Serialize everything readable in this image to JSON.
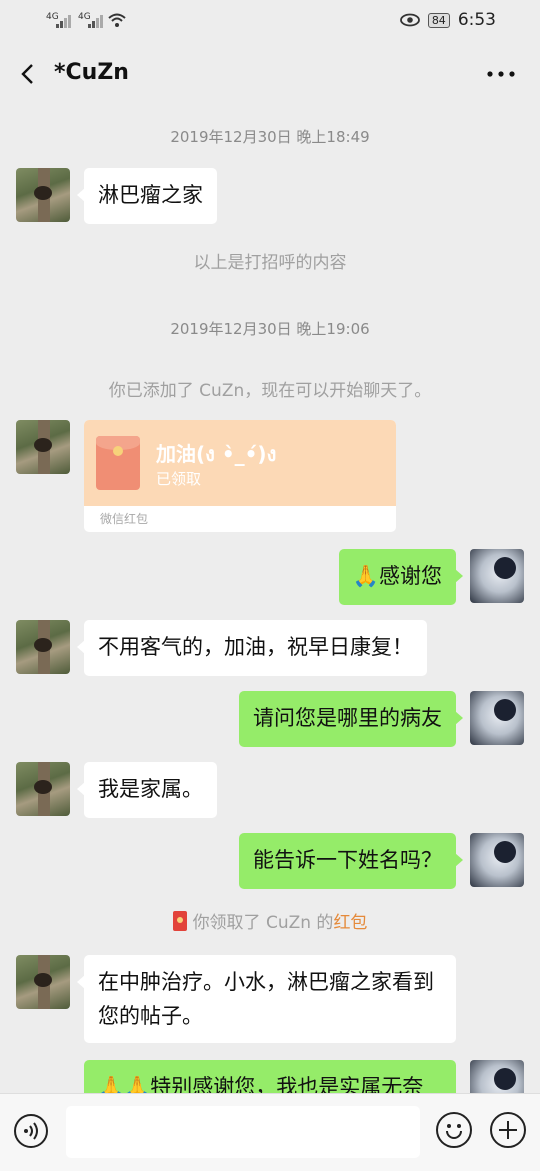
{
  "status_bar": {
    "signal_1": "4G",
    "signal_2": "4G",
    "battery": "84",
    "time": "6:53"
  },
  "header": {
    "title": "*CuZn",
    "back_icon": "chevron-left-icon",
    "more_icon": "more-dots-icon"
  },
  "chat": {
    "timestamp_1": "2019年12月30日 晚上18:49",
    "msg_1": "淋巴瘤之家",
    "system_1": "以上是打招呼的内容",
    "timestamp_2": "2019年12月30日 晚上19:06",
    "system_2": "你已添加了 CuZn，现在可以开始聊天了。",
    "red_packet": {
      "title": "加油(ง •̀_•́)ง",
      "status": "已领取",
      "footer": "微信红包"
    },
    "msg_2": "🙏感谢您",
    "msg_3": "不用客气的，加油，祝早日康复！",
    "msg_4": "请问您是哪里的病友",
    "msg_5": "我是家属。",
    "msg_6": "能告诉一下姓名吗？",
    "notice_prefix": "你领取了 CuZn 的",
    "notice_link": "红包",
    "msg_7": "在中肿治疗。小水，淋巴瘤之家看到您的帖子。",
    "msg_8": "🙏🙏特别感谢您，我也是实属无奈"
  },
  "colors": {
    "background": "#ededed",
    "bubble_me": "#95ec69",
    "bubble_other": "#ffffff",
    "red_packet": "#fcd9b6",
    "link": "#e58a3a"
  }
}
